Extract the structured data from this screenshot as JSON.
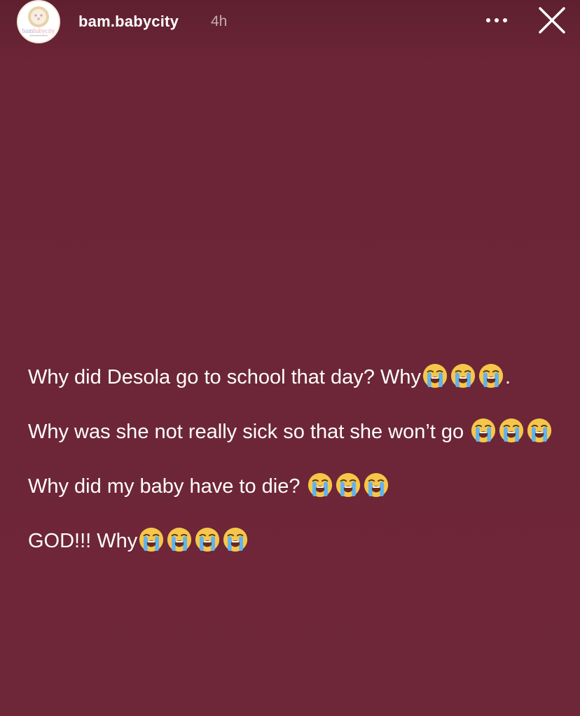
{
  "story": {
    "username": "bam.babycity",
    "time_ago": "4h",
    "avatar_logo_text": "bambabycity",
    "icons": {
      "more": "more-dots-icon",
      "close": "close-x-icon",
      "emoji": "loudly-crying-face-emoji"
    },
    "colors": {
      "background": "#6e2639",
      "text": "#ffffff"
    },
    "paragraphs": [
      {
        "text": "Why did Desola go to school that day? Why",
        "emojis_after": 3,
        "suffix": "."
      },
      {
        "text": "Why was she not really sick so that she won’t go ",
        "emojis_after": 3,
        "suffix": ""
      },
      {
        "text": "Why did my baby have to die? ",
        "emojis_after": 3,
        "suffix": ""
      },
      {
        "text": "GOD!!! Why",
        "emojis_after": 4,
        "suffix": ""
      }
    ]
  }
}
